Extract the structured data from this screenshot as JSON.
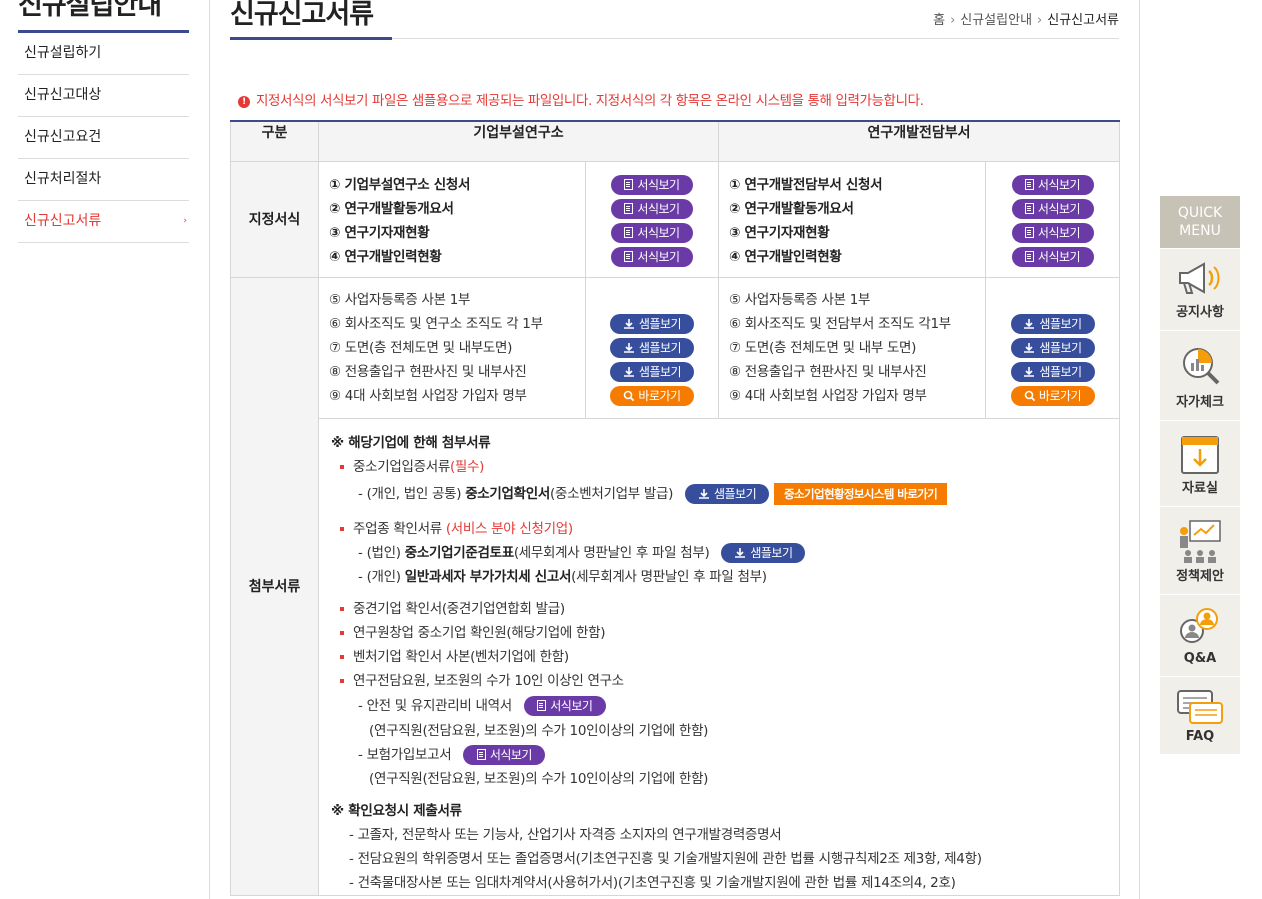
{
  "sidebar": {
    "title": "신규설립안내",
    "items": [
      {
        "label": "신규설립하기"
      },
      {
        "label": "신규신고대상"
      },
      {
        "label": "신규신고요건"
      },
      {
        "label": "신규처리절차"
      },
      {
        "label": "신규신고서류"
      }
    ],
    "active_arrow": "›"
  },
  "header": {
    "title": "신규신고서류",
    "breadcrumb": [
      "홈",
      "신규설립안내",
      "신규신고서류"
    ],
    "breadcrumb_sep": "›"
  },
  "notice": {
    "icon": "!",
    "text": "지정서식의 서식보기 파일은 샘플용으로 제공되는 파일입니다. 지정서식의 각 항목은 온라인 시스템을 통해 입력가능합니다."
  },
  "table": {
    "headers": {
      "category": "구분",
      "col1": "기업부설연구소",
      "col2": "연구개발전담부서"
    },
    "designated": {
      "label": "지정서식",
      "col1": [
        "① 기업부설연구소 신청서",
        "② 연구개발활동개요서",
        "③ 연구기자재현황",
        "④ 연구개발인력현황"
      ],
      "col2": [
        "① 연구개발전담부서 신청서",
        "② 연구개발활동개요서",
        "③ 연구기자재현황",
        "④ 연구개발인력현황"
      ],
      "button_label": "서식보기"
    },
    "docs": {
      "col1": [
        "⑤ 사업자등록증 사본 1부",
        "⑥ 회사조직도 및 연구소 조직도 각 1부",
        "⑦ 도면(층 전체도면 및 내부도면)",
        "⑧ 전용출입구 현판사진 및 내부사진",
        "⑨ 4대 사회보험 사업장 가입자 명부"
      ],
      "col2": [
        "⑤ 사업자등록증 사본 1부",
        "⑥ 회사조직도 및 전담부서 조직도 각1부",
        "⑦ 도면(층 전체도면 및 내부 도면)",
        "⑧ 전용출입구 현판사진 및 내부사진",
        "⑨ 4대 사회보험 사업장 가입자 명부"
      ],
      "sample_label": "샘플보기",
      "goto_label": "바로가기"
    },
    "attach": {
      "label": "첨부서류",
      "head1": "※ 해당기업에 한해 첨부서류",
      "sme": {
        "label": "중소기업입증서류",
        "req": "(필수)"
      },
      "sme_sub": {
        "pre": "-  (개인, 법인 공통) ",
        "bold": "중소기업확인서",
        "post": "(중소벤처기업부 발급)",
        "sys_label": "중소기업현황정보시스템 바로가기"
      },
      "biz": {
        "label": "주업종 확인서류 ",
        "note": "(서비스 분야 신청기업)"
      },
      "biz_sub1": {
        "pre": "-  (법인) ",
        "bold": "중소기업기준검토표",
        "post": "(세무회계사 명판날인 후 파일 첨부)"
      },
      "biz_sub2": {
        "pre": "-  (개인) ",
        "bold": "일반과세자 부가가치세 신고서",
        "post": "(세무회계사 명판날인 후 파일 첨부)"
      },
      "items": [
        "중견기업 확인서(중견기업연합회 발급)",
        "연구원창업 중소기업 확인원(해당기업에 한함)",
        "벤처기업 확인서 사본(벤처기업에 한함)",
        "연구전담요원, 보조원의 수가 10인 이상인 연구소"
      ],
      "safety": "-  안전 및 유지관리비 내역서",
      "safety_note": "(연구직원(전담요원, 보조원)의 수가 10인이상의 기업에 한함)",
      "insurance": "-  보험가입보고서",
      "insurance_note": "(연구직원(전담요원, 보조원)의 수가 10인이상의 기업에 한함)",
      "head2": "※ 확인요청시 제출서류",
      "extra": [
        "- 고졸자, 전문학사 또는 기능사, 산업기사 자격증 소지자의 연구개발경력증명서",
        "- 전담요원의 학위증명서 또는 졸업증명서(기초연구진흥 및 기술개발지원에 관한 법률 시행규칙제2조 제3항, 제4항)",
        "- 건축물대장사본 또는 임대차계약서(사용허가서)(기초연구진흥 및 기술개발지원에 관한 법률 제14조의4, 2호)"
      ]
    }
  },
  "quick_menu": {
    "title_line1": "QUICK",
    "title_line2": "MENU",
    "items": [
      {
        "label": "공지사항",
        "icon": "megaphone-icon"
      },
      {
        "label": "자가체크",
        "icon": "chart-magnifier-icon"
      },
      {
        "label": "자료실",
        "icon": "download-folder-icon"
      },
      {
        "label": "정책제안",
        "icon": "presentation-icon"
      },
      {
        "label": "Q&A",
        "icon": "qa-people-icon"
      },
      {
        "label": "FAQ",
        "icon": "faq-chat-icon"
      }
    ]
  },
  "colors": {
    "brand": "#3d4a8e",
    "accent_red": "#e53935",
    "purple": "#6a3aa6",
    "blue": "#364e9c",
    "orange": "#f57c00"
  }
}
